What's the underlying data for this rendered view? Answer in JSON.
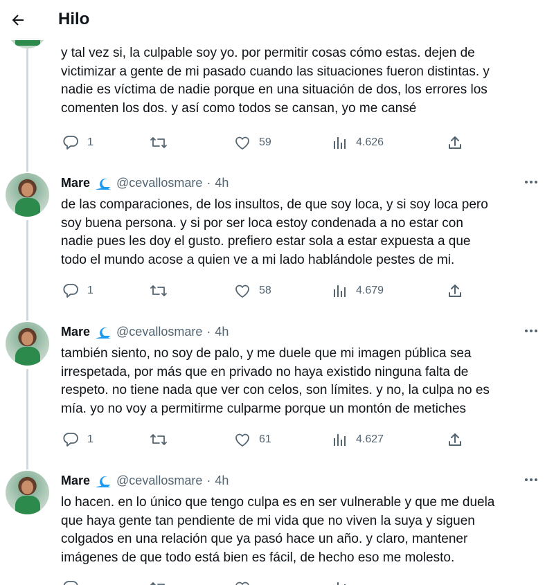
{
  "header": {
    "title": "Hilo",
    "back_icon": "arrow-left-icon"
  },
  "colors": {
    "text": "#0f1419",
    "secondary": "#536471",
    "thread_line": "#cfd9de",
    "verified_wave": "#1d9bf0"
  },
  "tweets": [
    {
      "text": "y tal vez si, la culpable soy yo. por permitir cosas cómo estas. dejen de\nvictimizar a gente de mi pasado cuando las situaciones fueron distintas. y\nnadie es víctima de nadie porque en una situación de dos, los errores los\ncomenten los dos. y así como todos se cansan, yo me cansé",
      "replies": "1",
      "retweets": "",
      "likes": "59",
      "views": "4.626"
    },
    {
      "name": "Mare",
      "handle": "@cevallosmare",
      "separator": "·",
      "time": "4h",
      "text": "de las comparaciones, de los insultos, de que soy loca, y si soy loca pero\nsoy buena persona. y si por ser loca estoy condenada a no estar con\nnadie pues les doy el gusto. prefiero estar sola a estar expuesta a que\ntodo el mundo acose a quien ve a mi lado hablándole pestes de mi.",
      "replies": "1",
      "retweets": "",
      "likes": "58",
      "views": "4.679"
    },
    {
      "name": "Mare",
      "handle": "@cevallosmare",
      "separator": "·",
      "time": "4h",
      "text": "también siento, no soy de palo, y me duele que mi imagen pública sea\nirrespetada, por más que en privado no haya existido ninguna falta de\nrespeto. no tiene nada que ver con celos, son límites. y no, la culpa no es\nmía. yo no voy a permitirme culparme porque un montón de metiches",
      "replies": "1",
      "retweets": "",
      "likes": "61",
      "views": "4.627"
    },
    {
      "name": "Mare",
      "handle": "@cevallosmare",
      "separator": "·",
      "time": "4h",
      "text": "lo hacen. en lo único que tengo culpa es en ser vulnerable y que me duela\nque haya gente tan pendiente de mi vida que no viven la suya y siguen\ncolgados en una relación que ya pasó hace un año. y claro, mantener\nimágenes de que todo está bien es fácil, de hecho eso me molesto."
    }
  ]
}
